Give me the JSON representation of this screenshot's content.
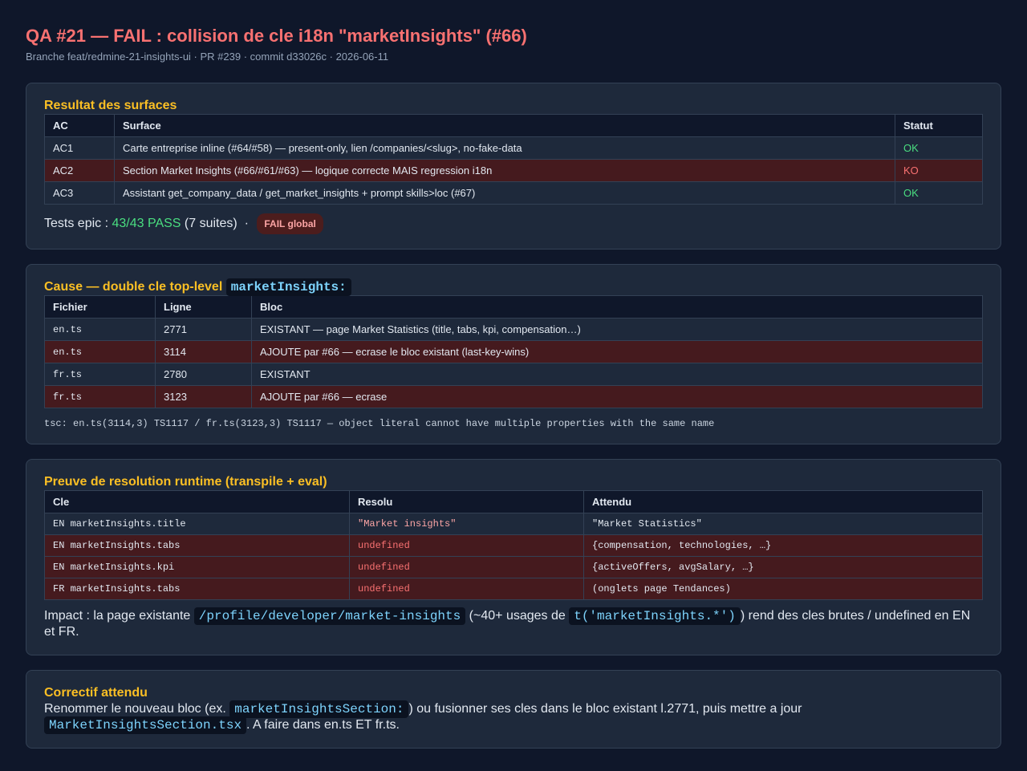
{
  "header": {
    "title": "QA #21 — FAIL : collision de cle i18n \"marketInsights\" (#66)",
    "subtitle": "Branche feat/redmine-21-insights-ui · PR #239 · commit d33026c · 2026-06-11"
  },
  "surfaces": {
    "heading": "Resultat des surfaces",
    "columns": [
      "AC",
      "Surface",
      "Statut"
    ],
    "rows": [
      {
        "ac": "AC1",
        "surface": "Carte entreprise inline (#64/#58) — present-only, lien /companies/<slug>, no-fake-data",
        "status": "OK"
      },
      {
        "ac": "AC2",
        "surface": "Section Market Insights (#66/#61/#63) — logique correcte MAIS regression i18n",
        "status": "KO"
      },
      {
        "ac": "AC3",
        "surface": "Assistant get_company_data / get_market_insights + prompt skills>loc (#67)",
        "status": "OK"
      }
    ],
    "summary_prefix": "Tests epic : ",
    "summary_pass": "43/43 PASS",
    "summary_suffix": " (7 suites)  · ",
    "badge": "FAIL global"
  },
  "cause": {
    "heading": "Cause — double cle top-level",
    "heading_code": "marketInsights:",
    "columns": [
      "Fichier",
      "Ligne",
      "Bloc"
    ],
    "rows": [
      {
        "file": "en.ts",
        "line": "2771",
        "bloc": "EXISTANT — page Market Statistics (title, tabs, kpi, compensation…)"
      },
      {
        "file": "en.ts",
        "line": "3114",
        "bloc": "AJOUTE par #66 — ecrase le bloc existant (last-key-wins)"
      },
      {
        "file": "fr.ts",
        "line": "2780",
        "bloc": "EXISTANT"
      },
      {
        "file": "fr.ts",
        "line": "3123",
        "bloc": "AJOUTE par #66 — ecrase"
      }
    ],
    "tsc": "tsc: en.ts(3114,3) TS1117 / fr.ts(3123,3) TS1117 — object literal cannot have multiple properties with the same name"
  },
  "proof": {
    "heading": "Preuve de resolution runtime (transpile + eval)",
    "columns": [
      "Cle",
      "Resolu",
      "Attendu"
    ],
    "rows": [
      {
        "key": "EN marketInsights.title",
        "resolved": "\"Market insights\"",
        "expected": "\"Market Statistics\""
      },
      {
        "key": "EN marketInsights.tabs",
        "resolved": "undefined",
        "expected": "{compensation, technologies, …}"
      },
      {
        "key": "EN marketInsights.kpi",
        "resolved": "undefined",
        "expected": "{activeOffers, avgSalary, …}"
      },
      {
        "key": "FR marketInsights.tabs",
        "resolved": "undefined",
        "expected": "(onglets page Tendances)"
      }
    ],
    "impact_prefix": "Impact : la page existante ",
    "impact_code1": "/profile/developer/market-insights",
    "impact_mid": " (~40+ usages de ",
    "impact_code2": "t('marketInsights.*')",
    "impact_suffix": ") rend des cles brutes / undefined en EN et FR."
  },
  "fix": {
    "heading": "Correctif attendu",
    "text_prefix": "Renommer le nouveau bloc (ex. ",
    "code1": "marketInsightsSection:",
    "text_mid": ") ou fusionner ses cles dans le bloc existant l.2771, puis mettre a jour ",
    "code2": "MarketInsightsSection.tsx",
    "text_suffix": ". A faire dans en.ts ET fr.ts."
  }
}
